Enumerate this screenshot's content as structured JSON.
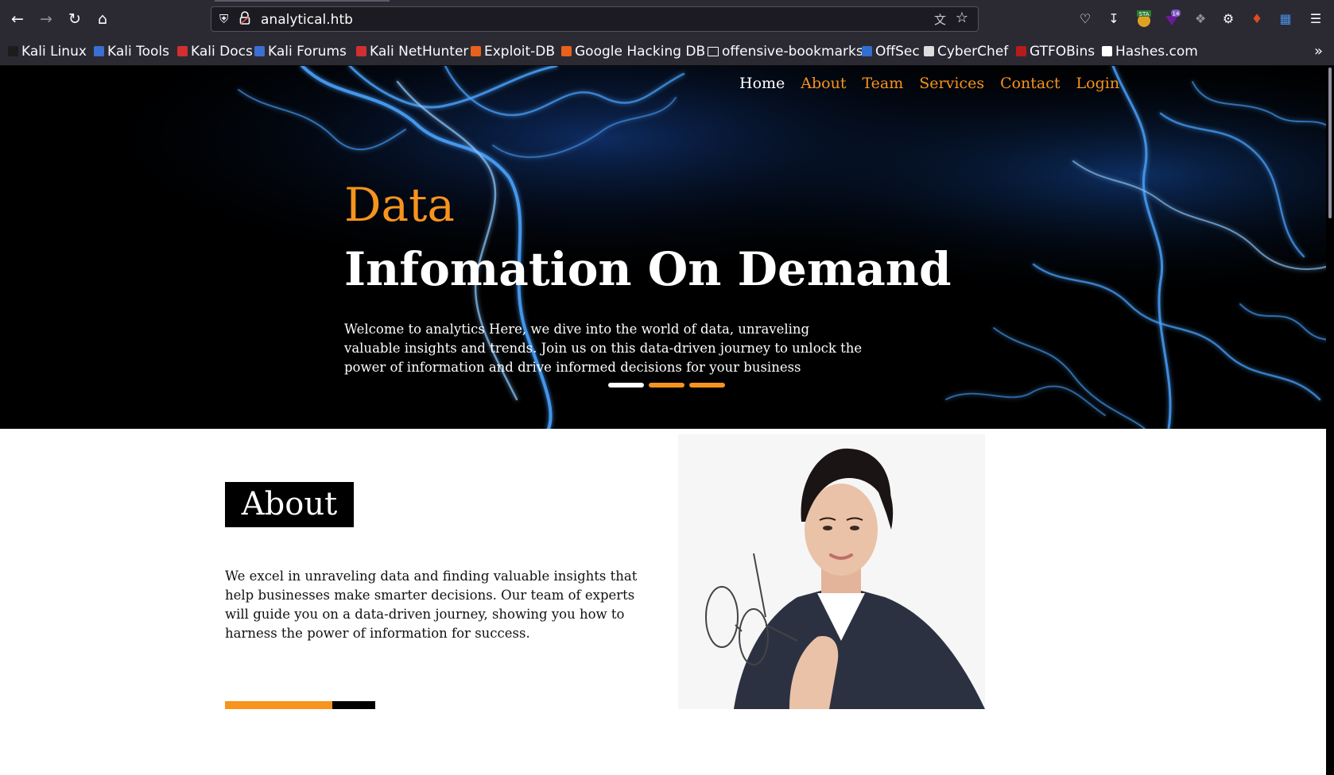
{
  "browser": {
    "url": "analytical.htb",
    "bookmarks": [
      {
        "label": "Kali Linux",
        "color": "#1c1c1c"
      },
      {
        "label": "Kali Tools",
        "color": "#3b6fd1"
      },
      {
        "label": "Kali Docs",
        "color": "#d32f2f"
      },
      {
        "label": "Kali Forums",
        "color": "#3b6fd1"
      },
      {
        "label": "Kali NetHunter",
        "color": "#d32f2f"
      },
      {
        "label": "Exploit-DB",
        "color": "#e8621c"
      },
      {
        "label": "Google Hacking DB",
        "color": "#e8621c"
      },
      {
        "label": "offensive-bookmarks",
        "color": "folder"
      },
      {
        "label": "OffSec",
        "color": "#2f6fd1"
      },
      {
        "label": "CyberChef",
        "color": "#dddddd"
      },
      {
        "label": "GTFOBins",
        "color": "#b71c1c"
      },
      {
        "label": "Hashes.com",
        "color": "#ffffff"
      }
    ],
    "extensions": {
      "badge1": "STA",
      "badge2": "14"
    }
  },
  "site": {
    "nav": [
      "Home",
      "About",
      "Team",
      "Services",
      "Contact",
      "Login"
    ],
    "hero": {
      "kicker": "Data",
      "title": "Infomation On Demand",
      "text": "Welcome to analytics Here, we dive into the world of data, unraveling valuable insights and trends. Join us on this data-driven journey to unlock the power of information and drive informed decisions for your business"
    },
    "about": {
      "heading": "About",
      "text": "We excel in unraveling data and finding valuable insights that help businesses make smarter decisions. Our team of experts will guide you on a data-driven journey, showing you how to harness the power of information for success."
    },
    "colors": {
      "accent": "#f7941d",
      "dark": "#000000"
    }
  }
}
